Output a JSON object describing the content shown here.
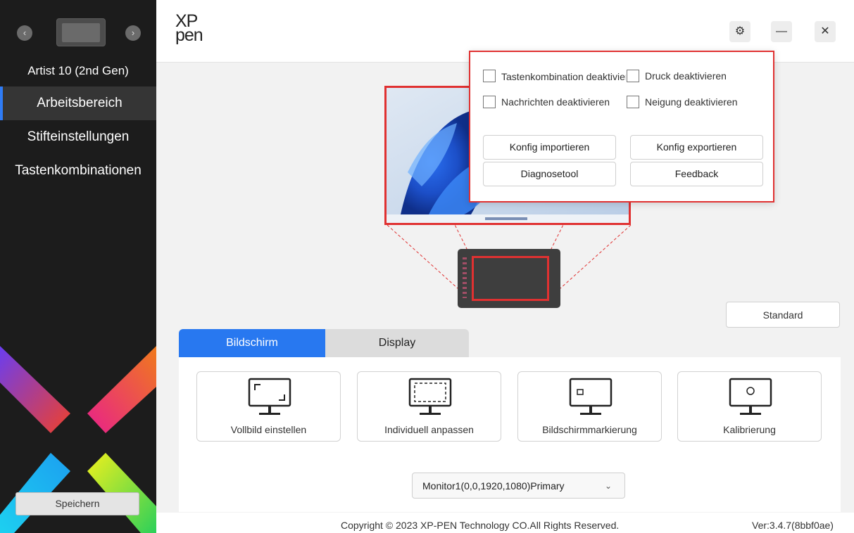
{
  "sidebar": {
    "device_name": "Artist 10 (2nd Gen)",
    "prev_label": "‹",
    "next_label": "›",
    "menu": [
      {
        "label": "Arbeitsbereich",
        "active": true
      },
      {
        "label": "Stifteinstellungen",
        "active": false
      },
      {
        "label": "Tastenkombinationen",
        "active": false
      }
    ],
    "save_label": "Speichern"
  },
  "header": {
    "logo_line1": "XP",
    "logo_line2": "pen",
    "settings_icon": "⚙",
    "minimize_icon": "—",
    "close_icon": "✕"
  },
  "settings_popup": {
    "checkboxes": [
      {
        "label": "Tastenkombination deaktivieren",
        "checked": false
      },
      {
        "label": "Druck deaktivieren",
        "checked": false
      },
      {
        "label": "Nachrichten deaktivieren",
        "checked": false
      },
      {
        "label": "Neigung deaktivieren",
        "checked": false
      }
    ],
    "buttons": {
      "import": "Konfig importieren",
      "export": "Konfig exportieren",
      "diagnose": "Diagnosetool",
      "feedback": "Feedback"
    }
  },
  "main": {
    "standard_label": "Standard",
    "tabs": [
      {
        "label": "Bildschirm",
        "active": true
      },
      {
        "label": "Display",
        "active": false
      }
    ],
    "cards": [
      {
        "label": "Vollbild einstellen",
        "icon": "fullscreen-monitor-icon"
      },
      {
        "label": "Individuell anpassen",
        "icon": "custom-area-monitor-icon"
      },
      {
        "label": "Bildschirmmarkierung",
        "icon": "screen-mark-monitor-icon"
      },
      {
        "label": "Kalibrierung",
        "icon": "calibration-monitor-icon"
      }
    ],
    "monitor_select": "Monitor1(0,0,1920,1080)Primary"
  },
  "footer": {
    "copyright": "Copyright © 2023  XP-PEN Technology CO.All Rights Reserved.",
    "version": "Ver:3.4.7(8bbf0ae)"
  },
  "colors": {
    "accent": "#2878f0",
    "highlight": "#e03131",
    "sidebar_bg": "#1c1c1c"
  }
}
